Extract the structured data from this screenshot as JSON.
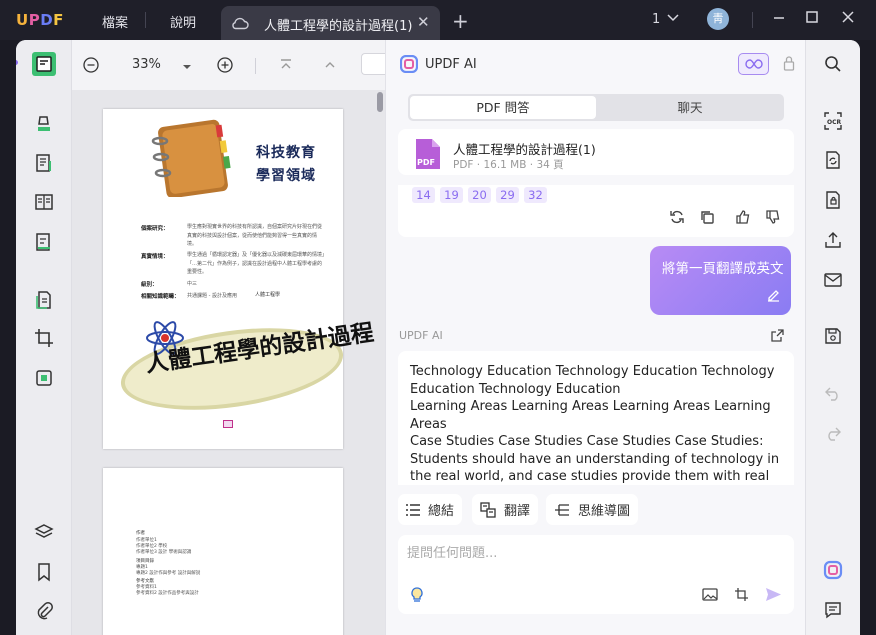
{
  "app": {
    "logo": "UPDF",
    "menu": [
      "檔案",
      "說明"
    ],
    "tab_title": "人體工程學的設計過程(1)",
    "page_indicator": "1",
    "avatar_initial": "靑"
  },
  "doc_toolbar": {
    "zoom": "33%"
  },
  "pdf_page1": {
    "heading_line1": "科技教育",
    "heading_line2": "學習領域",
    "rows": [
      {
        "label": "個案研究：",
        "text": "學生應對現實世界的科技有所認識，自個案研究片好現在們從真實的科技與設計個案，從而使他們能夠習得一些真實的情境。"
      },
      {
        "label": "真實情境：",
        "text": "學生通過「循環認定器」及「優化器以及減碳東屆環華的情境」「…第二代」作為例子，認識在設計過程中人體工程學考慮的重要性。"
      },
      {
        "label": "級別：",
        "text": "中三"
      },
      {
        "label": "相關知識範疇：",
        "text": "共通課題 - 設計及應用",
        "text2": "人體工程學"
      }
    ],
    "banner": "人體工程學的設計過程"
  },
  "pdf_page2": {
    "lines": [
      "作者",
      "作者單位1",
      "作者單位2 學校",
      "作者單位3 設計 學術與認識",
      "項目目錄",
      "專題1",
      "專題2 設計作與參考 設計與解說",
      "參考文獻",
      "參考資料1",
      "參考資料2 設計作品參考與設計"
    ]
  },
  "ai_panel": {
    "title": "UPDF AI",
    "tabs": [
      "PDF 問答",
      "聊天"
    ],
    "file_name": "人體工程學的設計過程(1)",
    "file_meta": "PDF · 16.1 MB · 34 頁",
    "file_icon_text": "PDF",
    "page_chips": [
      "14",
      "19",
      "20",
      "29",
      "32"
    ],
    "user_message": "將第一頁翻譯成英文",
    "response_label": "UPDF AI",
    "response_lines": [
      "Technology Education Technology Education Technology Education Technology Education",
      "Learning Areas Learning Areas Learning Areas Learning Areas",
      "Case Studies Case Studies Case Studies Case Studies: Students should have an understanding of technology in the real world, and case studies provide them with real examples"
    ],
    "actions": [
      "總結",
      "翻譯",
      "思維導圖"
    ],
    "input_placeholder": "提問任何問題..."
  },
  "colors": {
    "accent": "#8a6cf0",
    "titlebar": "#1f1f29",
    "tab": "#3a3a46"
  }
}
